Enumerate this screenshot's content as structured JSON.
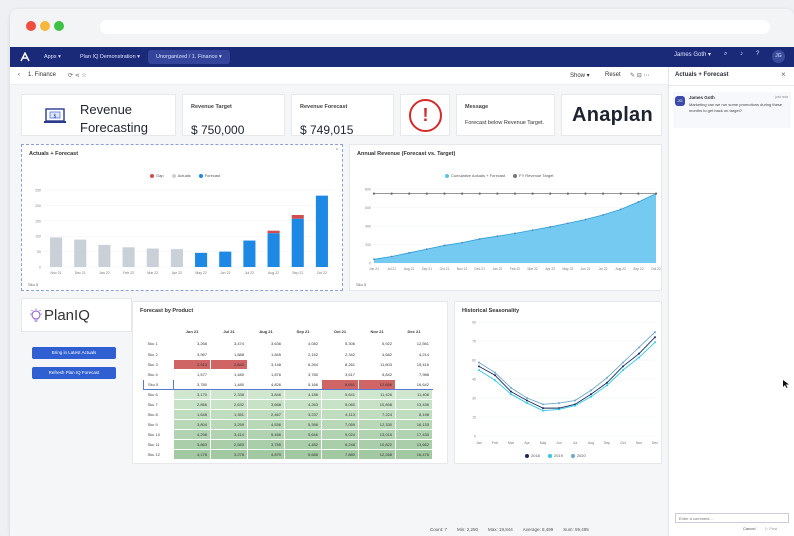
{
  "navbar": {
    "apps": "Apps",
    "model": "Plan IQ Demonstration",
    "module": "Unorganized / 1. Finance",
    "user": "James Goth"
  },
  "toolbar": {
    "title": "1. Finance",
    "show": "Show",
    "reset": "Reset"
  },
  "header": {
    "title_line1": "Revenue",
    "title_line2": "Forecasting",
    "target_label": "Revenue Target",
    "target_value": "$ 750,000",
    "forecast_label": "Revenue Forecast",
    "forecast_value": "$ 749,015",
    "message_label": "Message",
    "message_text": "Forecast below Revenue Target.",
    "brand": "Anaplan",
    "warning_glyph": "!"
  },
  "planiq": {
    "logo": "PlanIQ",
    "bring_button": "Bring in Latest Actuals",
    "refresh_button": "Refresh Plan IQ Forecast"
  },
  "chart_data": [
    {
      "type": "bar",
      "title": "Actuals + Forecast",
      "legend": [
        "Gap",
        "Actuals",
        "Forecast"
      ],
      "categories": [
        "Nov 21",
        "Dec 21",
        "Jan 22",
        "Feb 22",
        "Mar 22",
        "Apr 22",
        "May 22",
        "Jun 22",
        "Jul 22",
        "Aug 22",
        "Sep 22",
        "Oct 22"
      ],
      "series": [
        {
          "name": "Actuals",
          "values": [
            96,
            89,
            72,
            64,
            60,
            58,
            0,
            0,
            0,
            0,
            0,
            0
          ]
        },
        {
          "name": "Forecast",
          "values": [
            0,
            0,
            0,
            0,
            0,
            0,
            46,
            50,
            86,
            110,
            157,
            232
          ]
        },
        {
          "name": "Gap",
          "values": [
            0,
            0,
            0,
            0,
            0,
            0,
            0,
            0,
            0,
            8,
            12,
            0
          ]
        }
      ],
      "ylim": [
        0,
        260
      ],
      "footer": "Sku 5"
    },
    {
      "type": "area",
      "title": "Annual Revenue (Forecast vs. Target)",
      "legend": [
        "Cumulative Actuals + Forecast",
        "FY Revenue Target"
      ],
      "categories": [
        "Jun 21",
        "Jul 21",
        "Aug 21",
        "Sep 21",
        "Oct 21",
        "Nov 21",
        "Dec 21",
        "Jan 22",
        "Feb 22",
        "Mar 22",
        "Apr 22",
        "May 22",
        "Jun 22",
        "Jul 22",
        "Aug 22",
        "Sep 22",
        "Oct 22"
      ],
      "series": [
        {
          "name": "Cumulative Actuals + Forecast",
          "values": [
            40,
            70,
            110,
            150,
            190,
            220,
            260,
            290,
            320,
            355,
            390,
            430,
            470,
            520,
            580,
            660,
            750
          ]
        },
        {
          "name": "FY Revenue Target",
          "values": [
            750,
            750,
            750,
            750,
            750,
            750,
            750,
            750,
            750,
            750,
            750,
            750,
            750,
            750,
            750,
            750,
            750
          ]
        }
      ],
      "ylim": [
        0,
        800
      ],
      "footer": "Sku 5"
    },
    {
      "type": "line",
      "title": "Historical Seasonality",
      "legend": [
        "2018",
        "2019",
        "2020"
      ],
      "categories": [
        "Jan",
        "Feb",
        "Mar",
        "Apr",
        "May",
        "Jun",
        "Jul",
        "Aug",
        "Sep",
        "Oct",
        "Nov",
        "Dec"
      ],
      "series": [
        {
          "name": "2018",
          "values": [
            55,
            48,
            35,
            28,
            22,
            22,
            25,
            33,
            42,
            55,
            65,
            78
          ]
        },
        {
          "name": "2019",
          "values": [
            52,
            44,
            33,
            26,
            20,
            21,
            24,
            31,
            40,
            52,
            62,
            74
          ]
        },
        {
          "name": "2020",
          "values": [
            58,
            50,
            38,
            30,
            25,
            26,
            28,
            36,
            46,
            58,
            70,
            82
          ]
        }
      ],
      "ylim": [
        0,
        90
      ]
    }
  ],
  "forecast_table": {
    "title": "Forecast by Product",
    "columns": [
      "Jun 21",
      "Jul 21",
      "Aug 21",
      "Sep 21",
      "Oct 21",
      "Nov 21",
      "Dec 21"
    ],
    "rows": [
      {
        "label": "Sku 1",
        "values": [
          "3,268",
          "3,474",
          "3,636",
          "4,082",
          "5,306",
          "5,922",
          "12,561"
        ]
      },
      {
        "label": "Sku 2",
        "values": [
          "3,967",
          "1,888",
          "1,845",
          "2,152",
          "2,342",
          "4,682",
          "4,214"
        ]
      },
      {
        "label": "Sku 3",
        "values": [
          "2,913",
          "2,842",
          "3,148",
          "6,264",
          "8,261",
          "11,603",
          "15,416"
        ]
      },
      {
        "label": "Sku 4",
        "values": [
          "1,577",
          "1,480",
          "1,876",
          "3,780",
          "3,617",
          "5,842",
          "7,988"
        ]
      },
      {
        "label": "Sku 5",
        "values": [
          "3,780",
          "1,480",
          "4,826",
          "5,166",
          "8,651",
          "12,686",
          "16,642"
        ]
      },
      {
        "label": "Sku 6",
        "values": [
          "3,170",
          "2,338",
          "3,846",
          "4,188",
          "5,641",
          "11,426",
          "11,408"
        ]
      },
      {
        "label": "Sku 7",
        "values": [
          "2,856",
          "2,632",
          "3,668",
          "4,263",
          "5,060",
          "10,898",
          "13,436"
        ]
      },
      {
        "label": "Sku 8",
        "values": [
          "1,648",
          "1,351",
          "2,467",
          "3,237",
          "4,113",
          "7,224",
          "8,198"
        ]
      },
      {
        "label": "Sku 9",
        "values": [
          "3,804",
          "3,259",
          "4,536",
          "5,396",
          "7,059",
          "12,330",
          "16,133"
        ]
      },
      {
        "label": "Sku 10",
        "values": [
          "4,298",
          "3,414",
          "5,456",
          "5,646",
          "9,024",
          "13,016",
          "17,430"
        ]
      },
      {
        "label": "Sku 11",
        "values": [
          "3,863",
          "2,583",
          "3,785",
          "4,482",
          "6,248",
          "10,822",
          "13,662"
        ]
      },
      {
        "label": "Sku 12",
        "values": [
          "4,178",
          "3,278",
          "4,875",
          "5,686",
          "7,880",
          "12,268",
          "16,476"
        ]
      }
    ]
  },
  "sidebar": {
    "title": "Actuals + Forecast",
    "author": "James Goth",
    "avatar": "JG",
    "time": "just now",
    "comment": "Marketing can we run some promotions during these months to get back on target?",
    "input_placeholder": "Enter a comment...",
    "cancel": "Cancel",
    "post": "Post"
  },
  "statusbar": [
    "Count: 7",
    "Min: 2,250",
    "Max: 19,844",
    "Average: 8,499",
    "Sum: 59,495"
  ]
}
